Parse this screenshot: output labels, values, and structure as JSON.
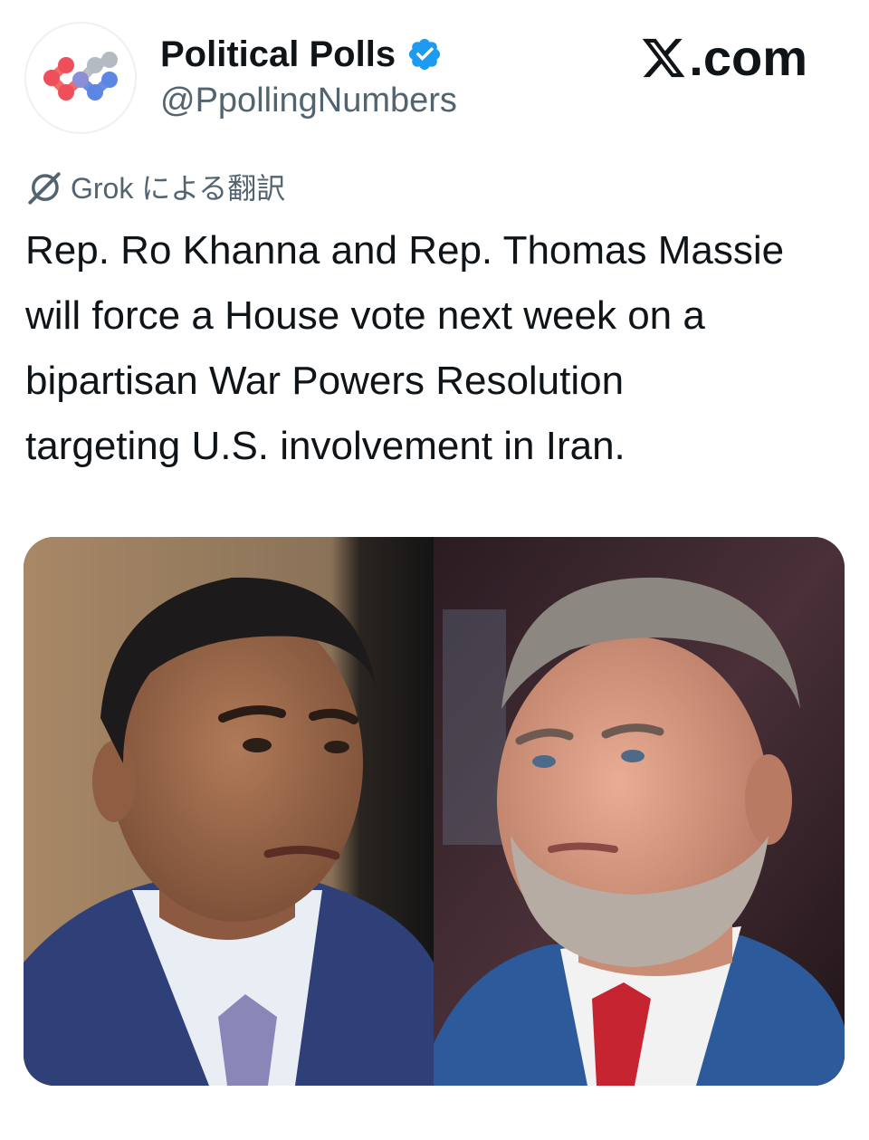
{
  "account": {
    "display_name": "Political Polls",
    "handle": "@PpollingNumbers",
    "verified": true,
    "avatar_icon": "political-polls-logo-icon"
  },
  "brand": {
    "label": ".com",
    "icon": "x-logo-icon"
  },
  "translation": {
    "label": "Grok による翻訳",
    "icon": "grok-icon"
  },
  "tweet": {
    "lines": [
      "Rep. Ro Khanna and Rep. Thomas Massie",
      "will force a House vote next week on a",
      "bipartisan War Powers Resolution",
      "targeting U.S. involvement in Iran."
    ]
  },
  "media": {
    "left_photo": "portrait-ro-khanna",
    "right_photo": "portrait-thomas-massie"
  },
  "colors": {
    "verified_blue": "#1d9bf0",
    "text_primary": "#0f1419",
    "text_secondary": "#536471"
  }
}
